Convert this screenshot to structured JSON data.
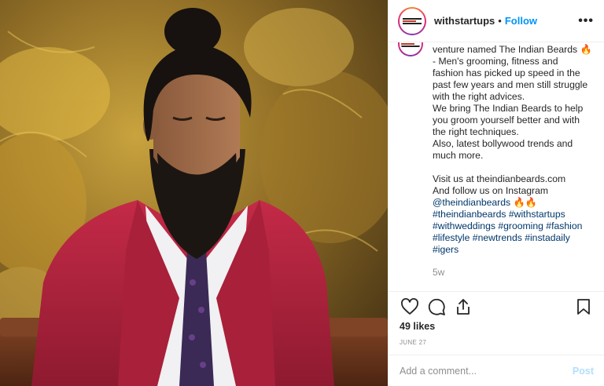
{
  "post": {
    "username": "withstartups",
    "separator": "•",
    "follow_label": "Follow",
    "more_label": "•••",
    "caption_lines": [
      {
        "text": "venture named The Indian Beards ",
        "emoji": "🔥"
      },
      {
        "text": "- Men's grooming, fitness and"
      },
      {
        "text": "fashion has picked up speed in the"
      },
      {
        "text": "past few years and men still struggle"
      },
      {
        "text": "with the right advices."
      },
      {
        "text": "We bring The Indian Beards to help"
      },
      {
        "text": "you groom yourself better and with"
      },
      {
        "text": "the right techniques."
      },
      {
        "text": "Also, latest bollywood trends and"
      },
      {
        "text": "much more."
      },
      {
        "text": ""
      },
      {
        "text": "Visit us at theindianbeards.com"
      },
      {
        "text": "And follow us on Instagram"
      }
    ],
    "mention": "@theindianbeards",
    "mention_emoji": "🔥🔥",
    "hashtag_lines": [
      "#theindianbeards #withstartups",
      "#withweddings #grooming #fashion",
      "#lifestyle #newtrends #instadaily",
      "#igers"
    ],
    "age": "5w",
    "likes": "49 likes",
    "date": "JUNE 27",
    "comment_placeholder": "Add a comment...",
    "post_label": "Post"
  },
  "icons": {
    "like": "heart-icon",
    "comment": "comment-icon",
    "share": "share-icon",
    "save": "bookmark-icon"
  },
  "colors": {
    "follow": "#0095f6",
    "post_disabled": "#b2dffc",
    "muted": "#8e8e8e",
    "link": "#00376b",
    "jacket": "#b8233f"
  }
}
